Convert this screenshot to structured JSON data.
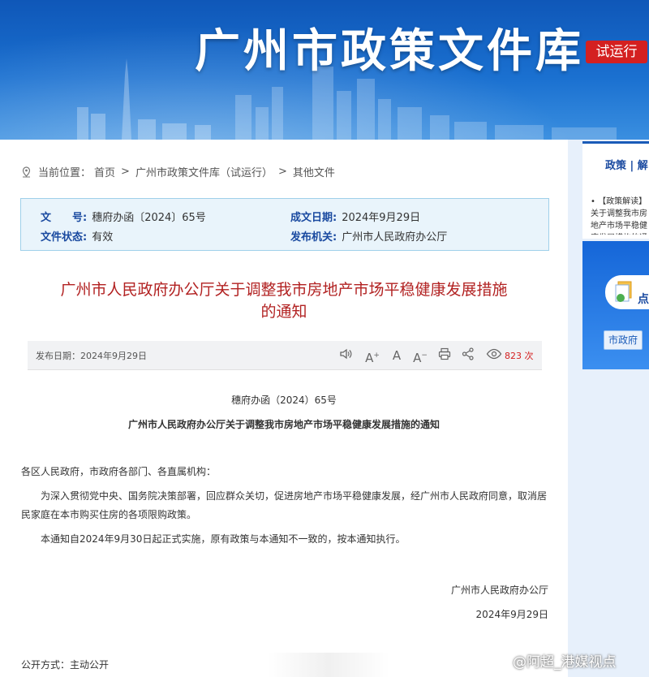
{
  "banner": {
    "title": "广州市政策文件库",
    "badge": "试运行"
  },
  "breadcrumb": {
    "prefix": "当前位置：",
    "items": [
      "首页",
      "广州市政策文件库（试运行）",
      "其他文件"
    ],
    "sep": ">"
  },
  "info": {
    "doc_no_label": "文　　号:",
    "doc_no": "穗府办函〔2024〕65号",
    "date_label": "成文日期:",
    "date": "2024年9月29日",
    "status_label": "文件状态:",
    "status": "有效",
    "issuer_label": "发布机关:",
    "issuer": "广州市人民政府办公厅"
  },
  "title_lines": [
    "广州市人民政府办公厅关于调整我市房地产市场平稳健康发展措施",
    "的通知"
  ],
  "toolbar": {
    "pub_date": "发布日期：2024年9月29日",
    "views_num": "823",
    "views_unit": "次",
    "icons": [
      "speaker-icon",
      "font-increase-icon",
      "font-normal-icon",
      "font-decrease-icon",
      "print-icon",
      "share-icon",
      "eye-icon"
    ]
  },
  "body": {
    "doc_number": "穗府办函（2024）65号",
    "subtitle": "广州市人民政府办公厅关于调整我市房地产市场平稳健康发展措施的通知",
    "salutation": "各区人民政府，市政府各部门、各直属机构：",
    "para1": "为深入贯彻党中央、国务院决策部署，回应群众关切，促进房地产市场平稳健康发展，经广州市人民政府同意，取消居民家庭在本市购买住房的各项限购政策。",
    "para2": "本通知自2024年9月30日起正式实施，原有政策与本通知不一致的，按本通知执行。",
    "sign_org": "广州市人民政府办公厅",
    "sign_date": "2024年9月29日",
    "disclosure": "公开方式：主动公开"
  },
  "sidebar": {
    "tabs": "政策 | 解",
    "news": "• 【政策解读】关于调整我市房地产市场平稳健康发展措施的通知",
    "pill": "点",
    "button": "市政府"
  },
  "watermark": "@阿超_港媒视点",
  "colors": {
    "banner": "#1a70d0",
    "title_red": "#b22222",
    "label_blue": "#1a4aa0",
    "badge_red": "#d42020",
    "info_bg": "#e9f4fb"
  }
}
